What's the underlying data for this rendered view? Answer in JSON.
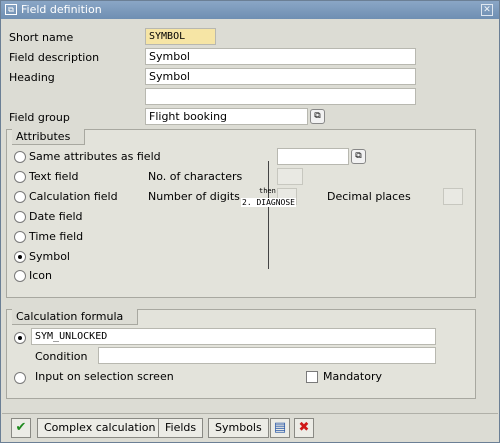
{
  "window": {
    "title": "Field definition",
    "close_glyph": "✕"
  },
  "top": {
    "short_name_label": "Short name",
    "short_name_value": "SYMBOL",
    "desc_label": "Field description",
    "desc_value": "Symbol",
    "heading_label": "Heading",
    "heading_value": "Symbol",
    "heading2_value": "",
    "group_label": "Field group",
    "group_value": "Flight booking"
  },
  "attributes": {
    "title": "Attributes",
    "options": [
      {
        "label": "Same attributes as field",
        "selected": false
      },
      {
        "label": "Text field",
        "selected": false
      },
      {
        "label": "Calculation field",
        "selected": false
      },
      {
        "label": "Date field",
        "selected": false
      },
      {
        "label": "Time field",
        "selected": false
      },
      {
        "label": "Symbol",
        "selected": true
      },
      {
        "label": "Icon",
        "selected": false
      }
    ],
    "same_attr_value": "",
    "num_chars_label": "No. of characters",
    "num_chars_value": "",
    "num_digits_label": "Number of digits",
    "decimal_label": "Decimal places",
    "decimal_value": "",
    "overlay_small": "then",
    "overlay_text": "2. DIAGNOSE"
  },
  "calc": {
    "title": "Calculation formula",
    "formula_value": "SYM_UNLOCKED",
    "formula_selected": true,
    "condition_label": "Condition",
    "condition_value": "",
    "input_label": "Input on selection screen",
    "input_selected": false,
    "mandatory_label": "Mandatory",
    "mandatory_checked": false
  },
  "toolbar": {
    "complex_label": "Complex calculation",
    "fields_label": "Fields",
    "symbols_label": "Symbols"
  },
  "colors": {
    "titlebar": "#7f9cbe",
    "required": "#f6e5a5",
    "confirm": "#1f8a1f",
    "cancel": "#d01818"
  }
}
